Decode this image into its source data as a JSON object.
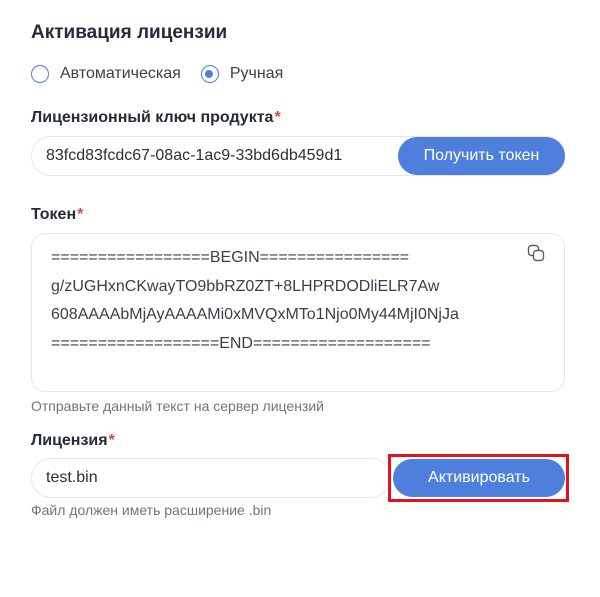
{
  "title": "Активация лицензии",
  "mode": {
    "options": [
      {
        "label": "Автоматическая",
        "checked": false
      },
      {
        "label": "Ручная",
        "checked": true
      }
    ]
  },
  "product_key": {
    "label": "Лицензионный ключ продукта",
    "required_mark": "*",
    "value": "83fcd83fcdc67-08ac-1ac9-33bd6db459d1",
    "button_label": "Получить токен"
  },
  "token": {
    "label": "Токен",
    "required_mark": "*",
    "lines": [
      "=================BEGIN================",
      "g/zUGHxnCKwayTO9bbRZ0ZT+8LHPRDODliELR7Aw",
      "608AAAAbMjAyAAAAMi0xMVQxMTo1Njo0My44MjI0NjJa",
      "==================END==================="
    ],
    "hint": "Отправьте данный текст на сервер лицензий",
    "copy_icon": "copy-icon"
  },
  "license": {
    "label": "Лицензия",
    "required_mark": "*",
    "value": "test.bin",
    "button_label": "Активировать",
    "hint": "Файл должен иметь расширение .bin"
  },
  "colors": {
    "accent": "#4f7fdc",
    "required": "#e0453a",
    "highlight": "#e0141b"
  }
}
